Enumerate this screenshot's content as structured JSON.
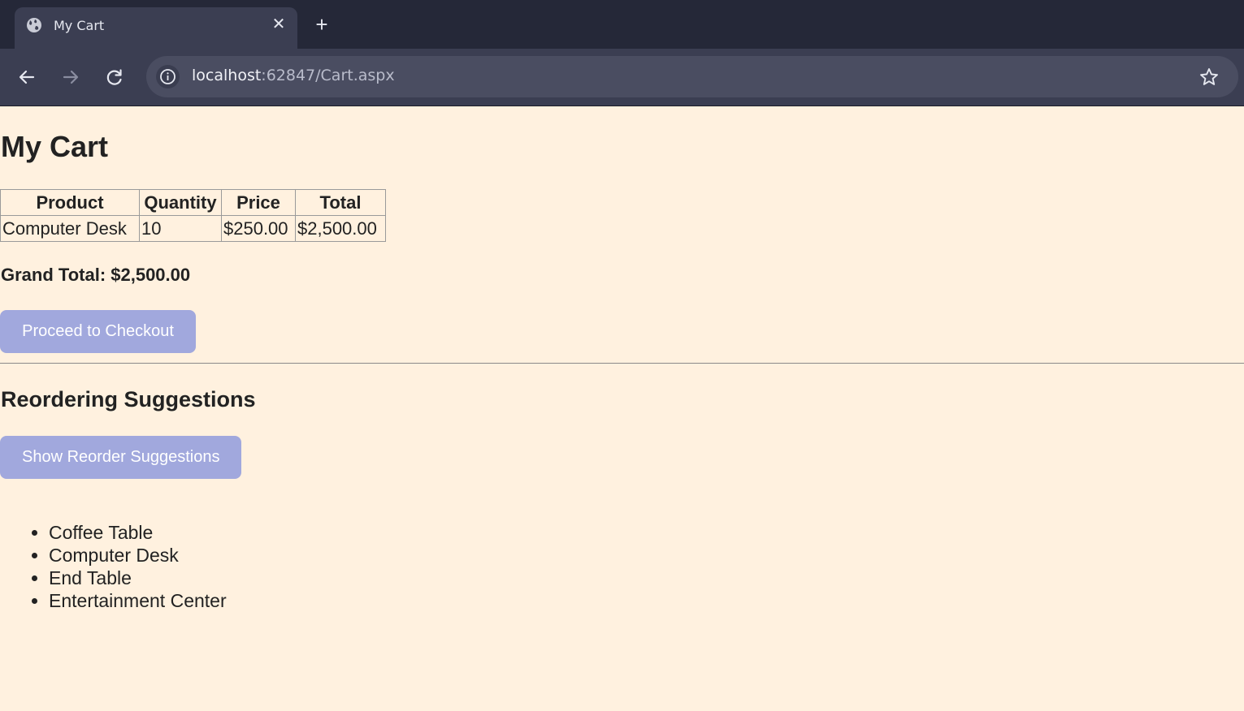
{
  "browser": {
    "tab_title": "My Cart",
    "url_host": "localhost",
    "url_rest": ":62847/Cart.aspx"
  },
  "page": {
    "title": "My Cart",
    "table": {
      "headers": [
        "Product",
        "Quantity",
        "Price",
        "Total"
      ],
      "rows": [
        [
          "Computer Desk",
          "10",
          "$250.00",
          "$2,500.00"
        ]
      ]
    },
    "grand_total": "Grand Total: $2,500.00",
    "checkout_button": "Proceed to Checkout",
    "section_title": "Reordering Suggestions",
    "reorder_button": "Show Reorder Suggestions",
    "suggestions": [
      "Coffee Table",
      "Computer Desk",
      "End Table",
      "Entertainment Center"
    ]
  },
  "colors": {
    "page_background": "#fff1df",
    "button_background": "#a1a8dd",
    "chrome_dark": "#252838",
    "toolbar": "#3b3e52"
  },
  "icons": [
    "globe-icon",
    "close-icon",
    "plus-icon",
    "back-arrow-icon",
    "forward-arrow-icon",
    "reload-icon",
    "info-icon",
    "star-icon"
  ]
}
